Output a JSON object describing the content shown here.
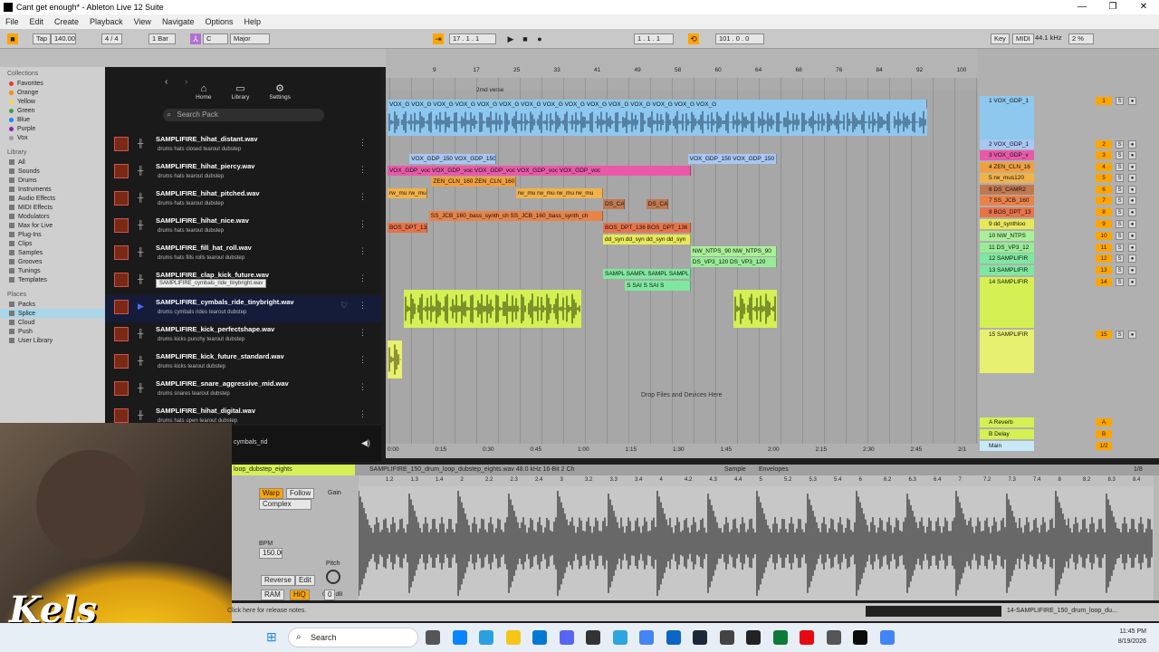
{
  "window": {
    "title": "Cant get enough* - Ableton Live 12 Suite",
    "min": "—",
    "restore": "❐",
    "close": "✕"
  },
  "menu": [
    "File",
    "Edit",
    "Create",
    "Playback",
    "View",
    "Navigate",
    "Options",
    "Help"
  ],
  "control_bar": {
    "tap": "Tap",
    "tempo": "140.00",
    "meter": "4 / 4",
    "quant": "1 Bar",
    "key": "C",
    "scale": "Major",
    "position": "17 . 1 . 1",
    "loop_start": "1 . 1 . 1",
    "loop_len": "101 . 0 . 0",
    "key_btn": "Key",
    "midi": "MIDI",
    "sample_rate": "44.1 kHz",
    "cpu": "2 %"
  },
  "sidebar": {
    "collections_heading": "Collections",
    "collections": [
      {
        "label": "Favorites",
        "color": "#e53935"
      },
      {
        "label": "Orange",
        "color": "#fb8c00"
      },
      {
        "label": "Yellow",
        "color": "#fdd835"
      },
      {
        "label": "Green",
        "color": "#43a047"
      },
      {
        "label": "Blue",
        "color": "#1e88e5"
      },
      {
        "label": "Purple",
        "color": "#8e24aa"
      },
      {
        "label": "Vox",
        "color": "#9e9e9e"
      }
    ],
    "library_heading": "Library",
    "library": [
      "All",
      "Sounds",
      "Drums",
      "Instruments",
      "Audio Effects",
      "MIDI Effects",
      "Modulators",
      "Max for Live",
      "Plug-Ins",
      "Clips",
      "Samples",
      "Grooves",
      "Tunings",
      "Templates"
    ],
    "places_heading": "Places",
    "places": [
      "Packs",
      "Splice",
      "Cloud",
      "Push",
      "User Library"
    ]
  },
  "splice": {
    "nav": [
      {
        "label": "Home",
        "icon": "home-icon"
      },
      {
        "label": "Library",
        "icon": "folder-icon"
      },
      {
        "label": "Settings",
        "icon": "gear-icon"
      }
    ],
    "search_placeholder": "Search Pack",
    "samples": [
      {
        "name": "SAMPLIFIRE_hihat_distant.wav",
        "tags": "drums    hats    closed    tearout dubstep"
      },
      {
        "name": "SAMPLIFIRE_hihat_piercy.wav",
        "tags": "drums    hats    tearout dubstep"
      },
      {
        "name": "SAMPLIFIRE_hihat_pitched.wav",
        "tags": "drums    hats    tearout dubstep"
      },
      {
        "name": "SAMPLIFIRE_hihat_nice.wav",
        "tags": "drums    hats    tearout dubstep"
      },
      {
        "name": "SAMPLIFIRE_fill_hat_roll.wav",
        "tags": "drums    hats    fills    rolls    tearout dubstep"
      },
      {
        "name": "SAMPLIFIRE_clap_kick_future.wav",
        "tags": "drums    claps    kicks    tearout dubstep"
      },
      {
        "name": "SAMPLIFIRE_cymbals_ride_tinybright.wav",
        "tags": "drums    cymbals    rides    tearout dubstep"
      },
      {
        "name": "SAMPLIFIRE_kick_perfectshape.wav",
        "tags": "drums    kicks    punchy    tearout dubstep"
      },
      {
        "name": "SAMPLIFIRE_kick_future_standard.wav",
        "tags": "drums    kicks    tearout dubstep"
      },
      {
        "name": "SAMPLIFIRE_snare_aggressive_mid.wav",
        "tags": "drums    snares    tearout dubstep"
      },
      {
        "name": "SAMPLIFIRE_hihat_digital.wav",
        "tags": "drums    hats    open    tearout dubstep"
      }
    ],
    "tooltip": "SAMPLIFIRE_cymbals_ride_tinybright.wav",
    "player_label": "cymbals_rid"
  },
  "arrangement": {
    "ruler": [
      "9",
      "17",
      "25",
      "33",
      "41",
      "49",
      "58",
      "60",
      "64",
      "68",
      "76",
      "84",
      "92",
      "100"
    ],
    "locator": "2md verse",
    "time_ruler": [
      "0:00",
      "0:15",
      "0:30",
      "0:45",
      "1:00",
      "1:15",
      "1:30",
      "1:45",
      "2:00",
      "2:15",
      "2:30",
      "2:45"
    ],
    "page": "2/1",
    "drop_text": "Drop Files and Devices Here",
    "clips": [
      {
        "row": 0,
        "start": 0.003,
        "end": 0.914,
        "label": "VOX_G VOX_G VOX_G VOX_G VOX_G VOX_G VOX_G VOX_G VOX_G VOX_G VOX_G VOX_G VOX_G VOX_G VOX_G",
        "color": "#8fc8ee"
      },
      {
        "row": 2,
        "start": 0.04,
        "end": 0.186,
        "label": "VOX_GDP_150 VOX_GDP_150",
        "color": "#a9c7f2"
      },
      {
        "row": 2,
        "start": 0.51,
        "end": 0.66,
        "label": "VOX_GDP_150 VOX_GDP_150",
        "color": "#a9c7f2"
      },
      {
        "row": 3,
        "start": 0.003,
        "end": 0.515,
        "label": "VOX_GDP_voc VOX_GDP_voc VOX_GDP_voc VOX_GDP_voc VOX_GDP_voc",
        "color": "#e85aa8"
      },
      {
        "row": 4,
        "start": 0.077,
        "end": 0.22,
        "label": "ZEN_CLN_160 ZEN_CLN_160",
        "color": "#f0a040"
      },
      {
        "row": 5,
        "start": 0.003,
        "end": 0.07,
        "label": "rw_mu rw_mu",
        "color": "#f2b24a"
      },
      {
        "row": 5,
        "start": 0.22,
        "end": 0.367,
        "label": "rw_mu rw_mu rw_mu rw_mu",
        "color": "#f2b24a"
      },
      {
        "row": 6,
        "start": 0.367,
        "end": 0.404,
        "label": "DS_CA",
        "color": "#c07850"
      },
      {
        "row": 6,
        "start": 0.44,
        "end": 0.477,
        "label": "DS_CA",
        "color": "#c07850"
      },
      {
        "row": 7,
        "start": 0.073,
        "end": 0.367,
        "label": "SS_JCB_160_bass_synth_ch SS_JCB_160_bass_synth_ch",
        "color": "#e8834a"
      },
      {
        "row": 8,
        "start": 0.003,
        "end": 0.07,
        "label": "BOS_DPT_136",
        "color": "#e8734a"
      },
      {
        "row": 8,
        "start": 0.367,
        "end": 0.515,
        "label": "BOS_DPT_136 BOS_DPT_136",
        "color": "#e8734a"
      },
      {
        "row": 9,
        "start": 0.367,
        "end": 0.515,
        "label": "dd_syn dd_syn dd_syn dd_syn",
        "color": "#e8e858"
      },
      {
        "row": 10,
        "start": 0.515,
        "end": 0.66,
        "label": "NW_NTPS_90 NW_NTPS_90",
        "color": "#a9f098"
      },
      {
        "row": 11,
        "start": 0.515,
        "end": 0.66,
        "label": "DS_VP3_120 DS_VP3_120",
        "color": "#98ec98"
      },
      {
        "row": 12,
        "start": 0.367,
        "end": 0.515,
        "label": "SAMPL SAMPL SAMPL SAMPL",
        "color": "#7fe8a0"
      },
      {
        "row": 13,
        "start": 0.404,
        "end": 0.515,
        "label": "S SAI S SAI S",
        "color": "#7fe8a0"
      }
    ],
    "tracks": [
      {
        "name": "1 VOX_GDP_1",
        "color": "#8fc8ee",
        "num": "1",
        "tall": true
      },
      {
        "name": "2 VOX_GDP_1",
        "color": "#a9c7f2",
        "num": "2"
      },
      {
        "name": "3 VOX_GDP_v",
        "color": "#e85aa8",
        "num": "3"
      },
      {
        "name": "4 ZEN_CLN_16",
        "color": "#f0a040",
        "num": "4"
      },
      {
        "name": "5 rw_mus120",
        "color": "#f2b24a",
        "num": "5"
      },
      {
        "name": "6 DS_CAMR2",
        "color": "#c07850",
        "num": "6"
      },
      {
        "name": "7 SS_JCB_160",
        "color": "#e8834a",
        "num": "7"
      },
      {
        "name": "8 BOS_DPT_13",
        "color": "#e8734a",
        "num": "8"
      },
      {
        "name": "9 dd_synthloo",
        "color": "#e8e858",
        "num": "9"
      },
      {
        "name": "10 NW_NTPS",
        "color": "#a9f098",
        "num": "10"
      },
      {
        "name": "11 DS_VP3_12",
        "color": "#98ec98",
        "num": "11"
      },
      {
        "name": "12 SAMPLIFIR",
        "color": "#7fe8a0",
        "num": "12"
      },
      {
        "name": "13 SAMPLIFIR",
        "color": "#7fe8a0",
        "num": "13"
      },
      {
        "name": "14 SAMPLIFIR",
        "color": "#d4f054",
        "num": "14",
        "tall": true
      },
      {
        "name": "15 SAMPLIFIR",
        "color": "#e8f070",
        "num": "15",
        "tall": true
      }
    ],
    "returns": [
      {
        "name": "A Reverb",
        "num": "A"
      },
      {
        "name": "B Delay",
        "num": "B"
      },
      {
        "name": "Main",
        "num": "1/2"
      }
    ]
  },
  "detail": {
    "clip_name": "loop_dubstep_eights",
    "file_info": "SAMPLIFIRE_150_drum_loop_dubstep_eights.wav  48.0 kHz  16-Bit  2 Ch",
    "tab_sample": "Sample",
    "tab_envelopes": "Envelopes",
    "page": "1/8",
    "warp": "Warp",
    "follow": "Follow",
    "mode": "Complex",
    "gain": "Gain",
    "gain_val": "0.00 dB",
    "bpm": "BPM",
    "bpm_val": "150.00",
    "reverse": "Reverse",
    "edit": "Edit",
    "ram": "RAM",
    "hiq": "HiQ",
    "pitch": "Pitch",
    "pitch_val": "0",
    "ruler": [
      "1.2",
      "1.3",
      "1.4",
      "2",
      "2.2",
      "2.3",
      "2.4",
      "3",
      "3.2",
      "3.3",
      "3.4",
      "4",
      "4.2",
      "4.3",
      "4.4",
      "5",
      "5.2",
      "5.3",
      "5.4",
      "6",
      "6.2",
      "6.3",
      "6.4",
      "7",
      "7.2",
      "7.3",
      "7.4",
      "8",
      "8.2",
      "8.3",
      "8.4"
    ]
  },
  "statusbar": {
    "release": "Click here for release notes.",
    "track": "14-SAMPLIFIRE_150_drum_loop_du..."
  },
  "overlay": {
    "logo": "Kels"
  },
  "taskbar": {
    "search": "Search",
    "time": "11:45 PM",
    "date": "8/19/2026"
  }
}
